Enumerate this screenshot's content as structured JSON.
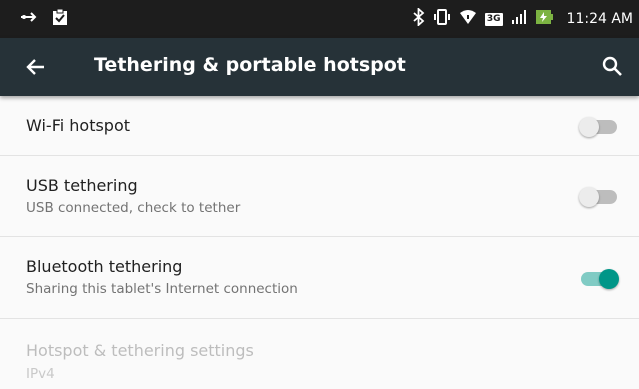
{
  "status_bar": {
    "time": "11:24 AM",
    "network": "3G",
    "icons": [
      "usb-icon",
      "clipboard-icon",
      "bluetooth-icon",
      "vibrate-icon",
      "wifi-icon",
      "network-type-icon",
      "signal-icon",
      "battery-charging-icon"
    ]
  },
  "appbar": {
    "title": "Tethering & portable hotspot",
    "background": "#263238"
  },
  "settings": [
    {
      "title": "Wi-Fi hotspot",
      "subtitle": "",
      "enabled": false
    },
    {
      "title": "USB tethering",
      "subtitle": "USB connected, check to tether",
      "enabled": false
    },
    {
      "title": "Bluetooth tethering",
      "subtitle": "Sharing this tablet's Internet connection",
      "enabled": true
    },
    {
      "title": "Hotspot & tethering settings",
      "subtitle": "IPv4",
      "disabled_item": true
    }
  ],
  "colors": {
    "accent": "#009688",
    "accent_track": "#80cbc4",
    "switch_off_track": "#bdbdbd"
  }
}
